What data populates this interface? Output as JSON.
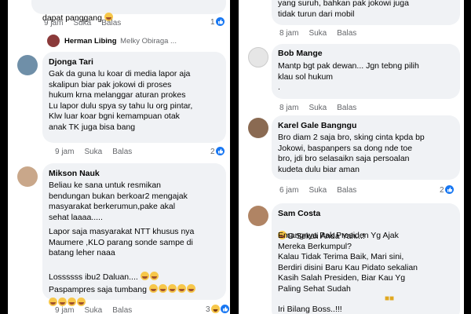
{
  "left": {
    "top_comment": {
      "text": "dapat panggang",
      "time": "9 jam",
      "like": "Suka",
      "reply": "Balas",
      "reactions": "1"
    },
    "reply_preview": {
      "name": "Herman Libing",
      "text": "Melky Obiraga ..."
    },
    "comments": [
      {
        "name": "Djonga Tari",
        "text": "Gak da guna lu koar di media lapor aja\nskalipun biar pak jokowi di proses\nhukum krna melanggar aturan prokes\n Lu lapor dulu spya sy tahu lu org pintar,\nKlw luar koar bgni kemampuan otak\nanak TK juga bisa bang",
        "time": "9 jam",
        "like": "Suka",
        "reply": "Balas",
        "reactions": "2"
      },
      {
        "name": "Mikson Nauk",
        "text": "Beliau ke sana untuk resmikan\nbendungan bukan berkoar2 mengajak\nmasyarakat berkerumun,pake akal\nsehat laaaa.....",
        "text2": "Lapor saja masyarakat NTT khusus nya\nMaumere ,KLO parang sonde sampe di\nbatang leher naaa",
        "text3": "Lossssss ibu2 Daluan....",
        "text4": "Paspampres saja tumbang",
        "time": "9 jam",
        "like": "Suka",
        "reply": "Balas",
        "reactions": "3"
      }
    ]
  },
  "right": {
    "top_comment": {
      "text": "yang suruh, bahkan pak jokowi juga\ntidak turun dari mobil",
      "time": "8 jam",
      "like": "Suka",
      "reply": "Balas"
    },
    "comments": [
      {
        "name": "Bob Mange",
        "text": "Mantp bgt pak dewan... Jgn tebng pilih\nklau sol hukum\n.",
        "time": "8 jam",
        "like": "Suka",
        "reply": "Balas"
      },
      {
        "name": "Karel Gale Bangngu",
        "text": "Bro diam 2 saja bro, sking cinta kpda bp\nJokowi, baspanpers sa dong nde toe\nbro, jdi bro selasaikn saja persoalan\nkudeta dulu biar aman",
        "time": "6 jam",
        "like": "Suka",
        "reply": "Balas",
        "reactions": "2"
      },
      {
        "name": "Sam Costa",
        "text_a": "G Sekali Anda Yah...!",
        "text": "Emangnya Pak Presiden Yg Ajak\nMereka Berkumpul?\nKalau Tidak Terima Baik, Mari sini,\nBerdiri disini Baru Kau Pidato sekalian\nKasih Salah Presiden, Biar Kau Yg\nPaling Sehat Sudah",
        "text_b": "Iri Bilang Boss..!!!"
      }
    ]
  },
  "colors": {
    "bubble": "#f0f2f5",
    "meta": "#65676b",
    "like_blue": "#1877f2",
    "haha_yellow": "#f7c74a"
  }
}
